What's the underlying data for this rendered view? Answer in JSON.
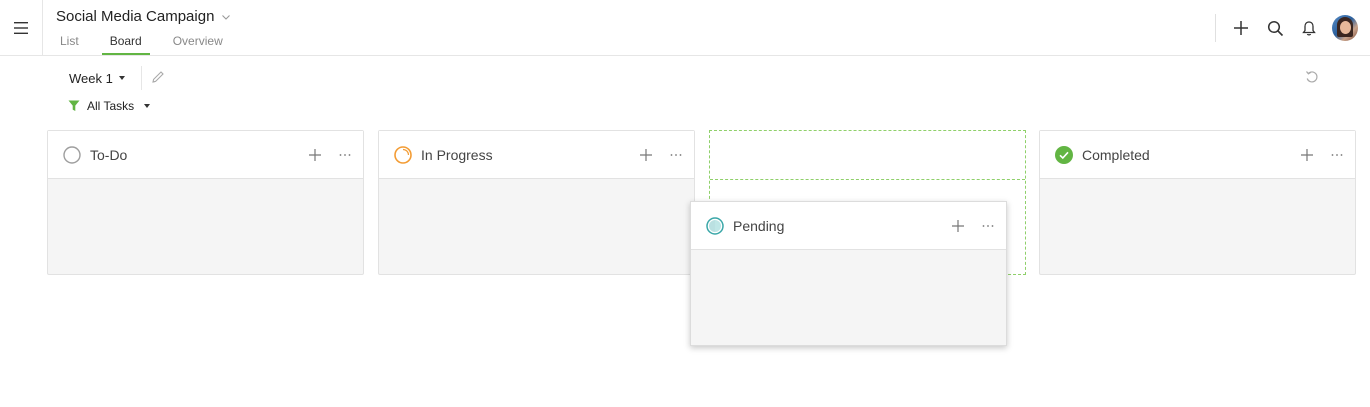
{
  "header": {
    "project_title": "Social Media Campaign",
    "tabs": [
      {
        "label": "List",
        "active": false
      },
      {
        "label": "Board",
        "active": true
      },
      {
        "label": "Overview",
        "active": false
      }
    ],
    "actions": [
      "plus-icon",
      "search-icon",
      "bell-icon",
      "avatar"
    ]
  },
  "toolbar": {
    "week_label": "Week 1",
    "filter_label": "All Tasks"
  },
  "columns": [
    {
      "title": "To-Do",
      "status": "circle-empty",
      "status_color": "#9e9e9e"
    },
    {
      "title": "In Progress",
      "status": "circle-progress",
      "status_color": "#f39c34"
    },
    {
      "title": "Pending",
      "status": "circle-half",
      "status_color": "#3aa7a8",
      "dragging": true
    },
    {
      "title": "Completed",
      "status": "circle-check",
      "status_color": "#62b543"
    }
  ],
  "colors": {
    "accent_green": "#62b543",
    "dropzone_border": "#8fd06a",
    "column_bg": "#f5f5f5"
  }
}
